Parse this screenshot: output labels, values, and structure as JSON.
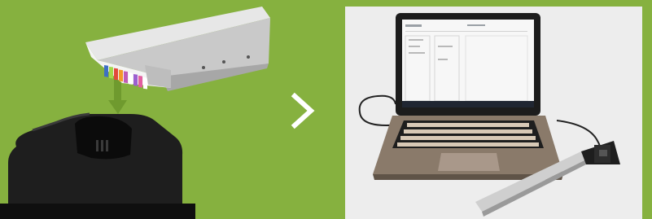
{
  "scene": {
    "background_color": "#86b13f",
    "left_panel": {
      "device_top": "sensor-cartridge",
      "device_bottom": "charging-dock",
      "connector_arrow": "down-arrow-icon"
    },
    "divider_icon": "chevron-right-icon",
    "right_photo": {
      "background_color": "#ededed",
      "subject": "laptop-with-attached-sensor-bar"
    }
  }
}
